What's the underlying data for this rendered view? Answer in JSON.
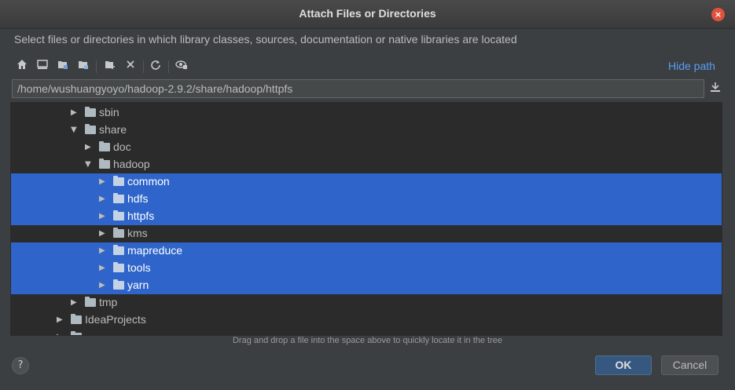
{
  "dialog": {
    "title": "Attach Files or Directories",
    "description": "Select files or directories in which library classes, sources, documentation or native libraries are located",
    "hide_path_label": "Hide path",
    "path_value": "/home/wushuangyoyo/hadoop-2.9.2/share/hadoop/httpfs",
    "hint": "Drag and drop a file into the space above to quickly locate it in the tree",
    "ok_label": "OK",
    "cancel_label": "Cancel",
    "help_label": "?",
    "close_label": "×"
  },
  "toolbar": {
    "icons": [
      "home-icon",
      "desktop-icon",
      "project-icon",
      "module-icon",
      "new-folder-icon",
      "delete-icon",
      "refresh-icon",
      "show-hidden-icon"
    ]
  },
  "tree": {
    "rows": [
      {
        "label": "sbin",
        "expanded": false,
        "selected": false
      },
      {
        "label": "share",
        "expanded": true,
        "selected": false
      },
      {
        "label": "doc",
        "expanded": false,
        "selected": false
      },
      {
        "label": "hadoop",
        "expanded": true,
        "selected": false
      },
      {
        "label": "common",
        "expanded": false,
        "selected": true
      },
      {
        "label": "hdfs",
        "expanded": false,
        "selected": true
      },
      {
        "label": "httpfs",
        "expanded": false,
        "selected": true
      },
      {
        "label": "kms",
        "expanded": false,
        "selected": false
      },
      {
        "label": "mapreduce",
        "expanded": false,
        "selected": true
      },
      {
        "label": "tools",
        "expanded": false,
        "selected": true
      },
      {
        "label": "yarn",
        "expanded": false,
        "selected": true
      },
      {
        "label": "tmp",
        "expanded": false,
        "selected": false
      },
      {
        "label": "IdeaProjects",
        "expanded": false,
        "selected": false
      }
    ]
  },
  "colors": {
    "selection": "#2f65ca",
    "link": "#589df6",
    "background": "#3c3f41"
  }
}
